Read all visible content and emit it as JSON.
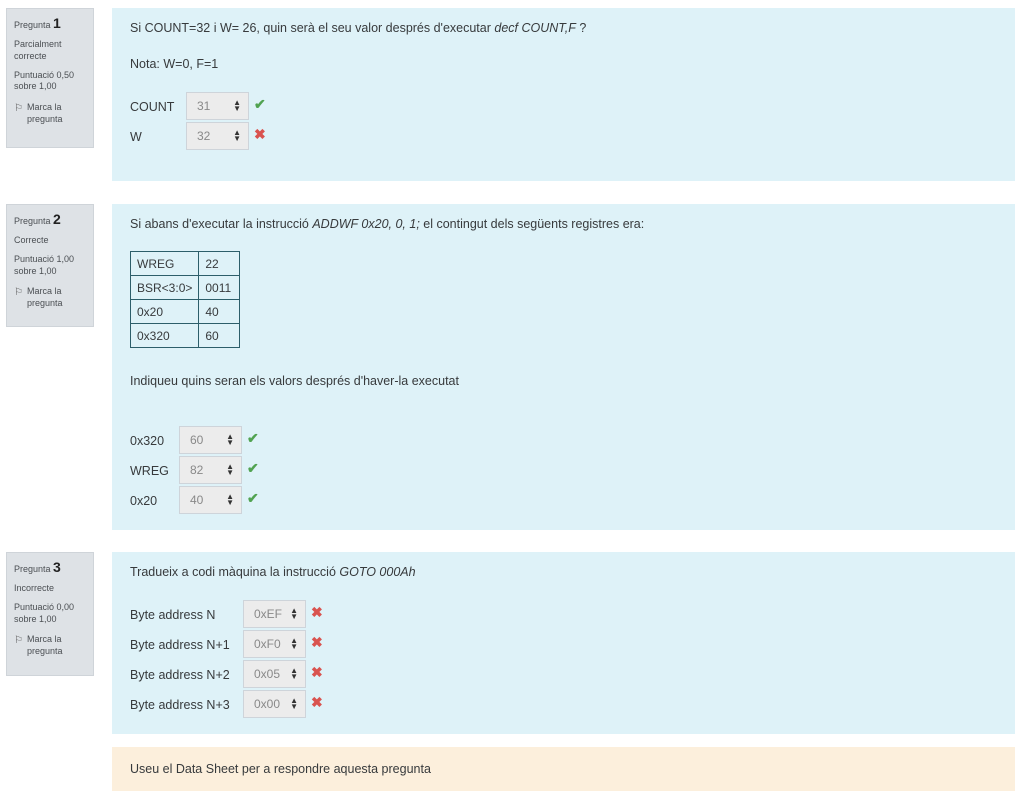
{
  "questions": [
    {
      "label": "Pregunta",
      "number": "1",
      "state": "Parcialment correcte",
      "grade": "Puntuació 0,50 sobre 1,00",
      "flag": "Marca la pregunta",
      "text_before": "Si COUNT=32 i W= 26, quin serà el seu valor després d'executar ",
      "text_italic": "decf COUNT,F",
      "text_after": " ?",
      "note": "Nota: W=0, F=1",
      "answers": [
        {
          "label": "COUNT",
          "value": "31",
          "result": "correct"
        },
        {
          "label": "W",
          "value": "32",
          "result": "incorrect"
        }
      ]
    },
    {
      "label": "Pregunta",
      "number": "2",
      "state": "Correcte",
      "grade": "Puntuació 1,00 sobre 1,00",
      "flag": "Marca la pregunta",
      "text_before": "Si abans d'executar la instrucció ",
      "text_italic": "ADDWF 0x20, 0, 1;",
      "text_after": " el contingut dels següents registres era:",
      "table": [
        [
          "WREG",
          "22"
        ],
        [
          "BSR<3:0>",
          "0011"
        ],
        [
          "0x20",
          "40"
        ],
        [
          "0x320",
          "60"
        ]
      ],
      "prompt": "Indiqueu quins seran els valors després d'haver-la executat",
      "answers": [
        {
          "label": "0x320",
          "value": "60",
          "result": "correct"
        },
        {
          "label": "WREG",
          "value": "82",
          "result": "correct"
        },
        {
          "label": "0x20",
          "value": "40",
          "result": "correct"
        }
      ]
    },
    {
      "label": "Pregunta",
      "number": "3",
      "state": "Incorrecte",
      "grade": "Puntuació 0,00 sobre 1,00",
      "flag": "Marca la pregunta",
      "text_before": "Tradueix a codi màquina la instrucció ",
      "text_italic": "GOTO 000Ah",
      "text_after": "",
      "answers": [
        {
          "label": "Byte address N",
          "value": "0xEF",
          "result": "incorrect"
        },
        {
          "label": "Byte address N+1",
          "value": "0xF0",
          "result": "incorrect"
        },
        {
          "label": "Byte address N+2",
          "value": "0x05",
          "result": "incorrect"
        },
        {
          "label": "Byte address N+3",
          "value": "0x00",
          "result": "incorrect"
        }
      ]
    }
  ],
  "hint": "Useu el Data Sheet per a respondre aquesta pregunta",
  "icons": {
    "correct": "check-icon",
    "incorrect": "cross-icon",
    "flag": "flag-icon",
    "select": "updown-arrow-icon"
  },
  "colors": {
    "correct": "#51a351",
    "incorrect": "#d9534f",
    "content_bg": "#def2f8",
    "hint_bg": "#fcefdc"
  }
}
